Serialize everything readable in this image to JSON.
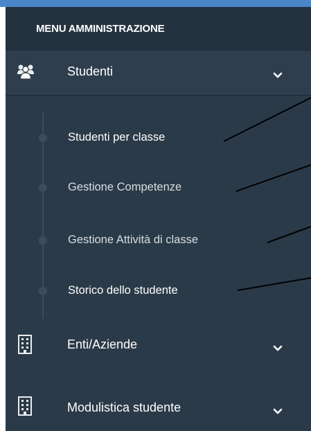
{
  "menu": {
    "header": "MENU AMMINISTRAZIONE",
    "items": [
      {
        "label": "Studenti",
        "icon": "users-icon",
        "expanded": true,
        "subitems": [
          {
            "label": "Studenti per classe",
            "color": "#ffffff"
          },
          {
            "label": "Gestione Competenze",
            "color": "#d7dde3"
          },
          {
            "label": "Gestione Attività di classe",
            "color": "#d7dde3"
          },
          {
            "label": "Storico dello studente",
            "color": "#ffffff"
          }
        ]
      },
      {
        "label": "Enti/Aziende",
        "icon": "building-icon",
        "expanded": false
      },
      {
        "label": "Modulistica studente",
        "icon": "building-icon",
        "expanded": false
      }
    ]
  },
  "colors": {
    "sidebar_bg": "#2b3a48",
    "header_bg": "#243240",
    "top_accent": "#4a86c8"
  }
}
